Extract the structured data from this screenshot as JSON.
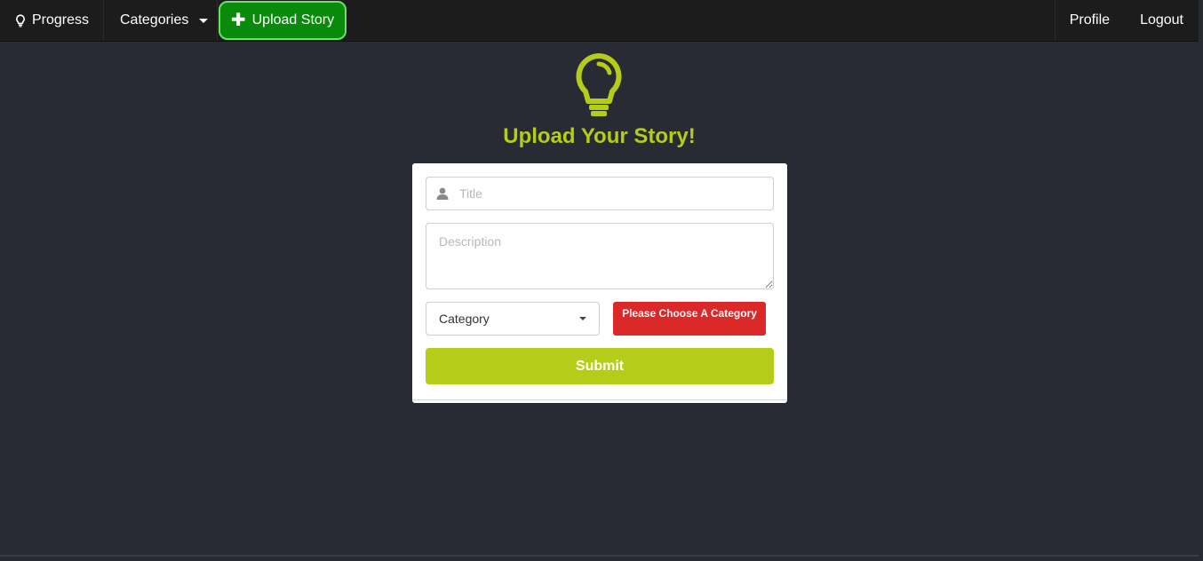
{
  "nav": {
    "progress_label": "Progress",
    "progress_icon": "lightbulb-icon",
    "categories_label": "Categories",
    "upload_label": "Upload Story",
    "upload_icon": "plus-icon",
    "profile_label": "Profile",
    "logout_label": "Logout"
  },
  "hero": {
    "icon": "lightbulb-icon",
    "heading": "Upload Your Story!"
  },
  "form": {
    "title_placeholder": "Title",
    "title_icon": "user-icon",
    "description_placeholder": "Description",
    "category_selected": "Category",
    "category_error": "Please Choose A Category",
    "submit_label": "Submit"
  },
  "colors": {
    "accent": "#b5cc18",
    "upload_green": "#0a8a0a",
    "error_red": "#db2828",
    "background": "#282b33",
    "navbar": "#1c1c1c"
  }
}
